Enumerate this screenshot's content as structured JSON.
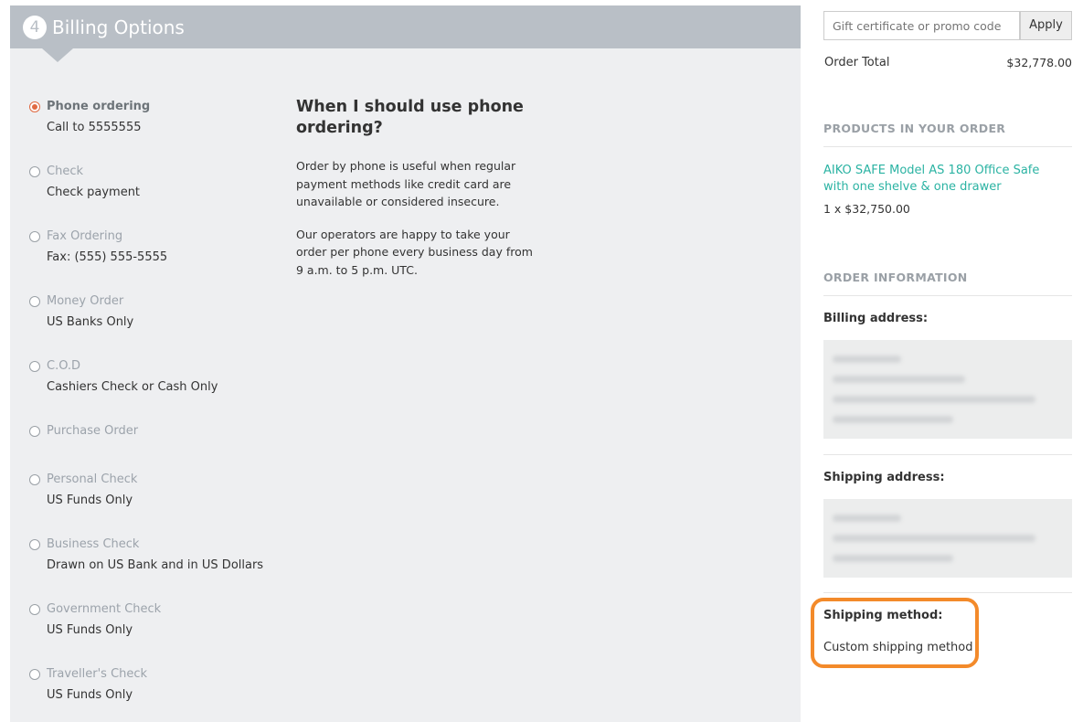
{
  "step": {
    "number": "4",
    "title": "Billing Options"
  },
  "payment_methods": [
    {
      "name": "Phone ordering",
      "desc": "Call to 5555555",
      "selected": true
    },
    {
      "name": "Check",
      "desc": "Check payment",
      "selected": false
    },
    {
      "name": "Fax Ordering",
      "desc": "Fax: (555) 555-5555",
      "selected": false
    },
    {
      "name": "Money Order",
      "desc": "US Banks Only",
      "selected": false
    },
    {
      "name": "C.O.D",
      "desc": "Cashiers Check or Cash Only",
      "selected": false
    },
    {
      "name": "Purchase Order",
      "desc": "",
      "selected": false
    },
    {
      "name": "Personal Check",
      "desc": "US Funds Only",
      "selected": false
    },
    {
      "name": "Business Check",
      "desc": "Drawn on US Bank and in US Dollars",
      "selected": false
    },
    {
      "name": "Government Check",
      "desc": "US Funds Only",
      "selected": false
    },
    {
      "name": "Traveller's Check",
      "desc": "US Funds Only",
      "selected": false
    }
  ],
  "info": {
    "title": "When I should use phone ordering?",
    "p1": "Order by phone is useful when regular payment methods like credit card are unavailable or considered insecure.",
    "p2": "Our operators are happy to take your order per phone every business day from 9 a.m. to 5 p.m. UTC."
  },
  "sidebar": {
    "promo_placeholder": "Gift certificate or promo code",
    "apply_label": "Apply",
    "order_total_label": "Order Total",
    "order_total_value": "$32,778.00",
    "products_title": "PRODUCTS IN YOUR ORDER",
    "product_name": "AIKO SAFE Model AS 180 Office Safe with one shelve & one drawer",
    "product_qty": "1 x $32,750.00",
    "order_info_title": "ORDER INFORMATION",
    "billing_label": "Billing address:",
    "shipping_label": "Shipping address:",
    "shipping_method_label": "Shipping method:",
    "shipping_method_value": "Custom shipping method"
  },
  "colors": {
    "accent": "#e06a43",
    "link": "#2bb3a3",
    "highlight": "#f38a2a",
    "header": "#b9bfc6"
  }
}
